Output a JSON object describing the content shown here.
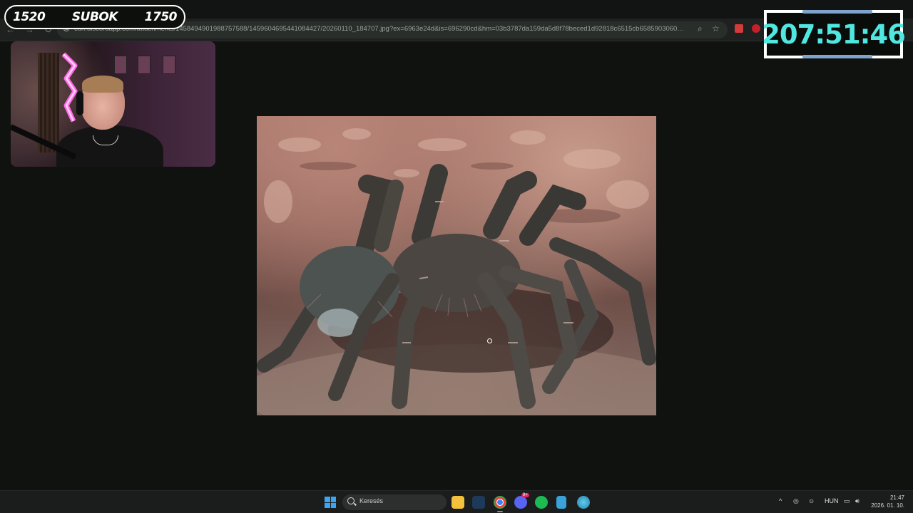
{
  "browser": {
    "url": "cdn.discordapp.com/attachments/1458494901988757588/1459604695441084427/20260110_184707.jpg?ex=6963e24d&is=696290cd&hm=03b3787da159da5d8f78beced1d92818c6515cb6585903060d9f6833..."
  },
  "overlay": {
    "counter_left": "1520",
    "counter_label": "SUBOK",
    "counter_right": "1750",
    "timer": "207:51:46"
  },
  "image": {
    "subject": "tarantula-photo"
  },
  "taskbar": {
    "search_placeholder": "Keresés",
    "discord_badge": "9+",
    "language": "HUN",
    "time": "21:47",
    "date": "2026. 01. 10."
  },
  "colors": {
    "timer_text": "#4fe7e0",
    "windows_blue": "#3ba5f3",
    "background": "#0f120f"
  }
}
